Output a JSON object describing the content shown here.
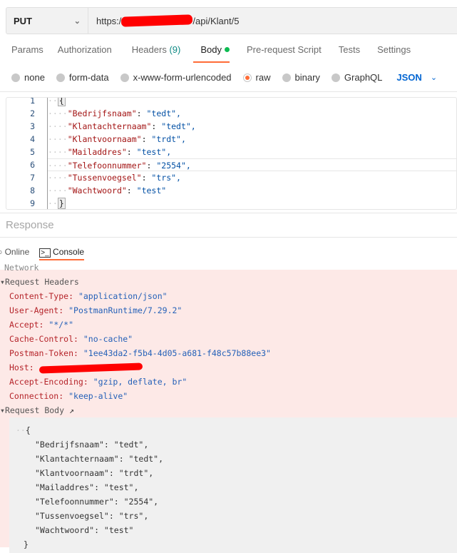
{
  "request": {
    "method": "PUT",
    "url_prefix": "https:/",
    "url_suffix": "/api/Klant/5"
  },
  "tabs": [
    {
      "label": "Params"
    },
    {
      "label": "Authorization"
    },
    {
      "label": "Headers",
      "count": "(9)"
    },
    {
      "label": "Body"
    },
    {
      "label": "Pre-request Script"
    },
    {
      "label": "Tests"
    },
    {
      "label": "Settings"
    }
  ],
  "body_types": [
    "none",
    "form-data",
    "x-www-form-urlencoded",
    "raw",
    "binary",
    "GraphQL"
  ],
  "selected_body_type": "raw",
  "format": "JSON",
  "editor": {
    "line_numbers": [
      "1",
      "2",
      "3",
      "4",
      "5",
      "6",
      "7",
      "8",
      "9"
    ],
    "open": "{",
    "close": "}",
    "fields": [
      {
        "key": "\"Bedrijfsnaam\"",
        "value": "\"tedt\","
      },
      {
        "key": "\"Klantachternaam\"",
        "value": "\"tedt\","
      },
      {
        "key": "\"Klantvoornaam\"",
        "value": "\"trdt\","
      },
      {
        "key": "\"Mailaddres\"",
        "value": "\"test\","
      },
      {
        "key": "\"Telefoonnummer\"",
        "value": "\"2554\","
      },
      {
        "key": "\"Tussenvoegsel\"",
        "value": "\"trs\","
      },
      {
        "key": "\"Wachtwoord\"",
        "value": "\"test\""
      }
    ]
  },
  "response_label": "Response",
  "bottom_tabs": {
    "online": "Online",
    "console": "Console"
  },
  "console": {
    "network": "Network",
    "request_headers": "Request Headers",
    "headers": [
      {
        "k": "Content-Type:",
        "v": "\"application/json\""
      },
      {
        "k": "User-Agent:",
        "v": "\"PostmanRuntime/7.29.2\""
      },
      {
        "k": "Accept:",
        "v": "\"*/*\""
      },
      {
        "k": "Cache-Control:",
        "v": "\"no-cache\""
      },
      {
        "k": "Postman-Token:",
        "v": "\"1ee43da2-f5b4-4d05-a681-f48c57b88ee3\""
      },
      {
        "k": "Host:",
        "v": ""
      },
      {
        "k": "Accept-Encoding:",
        "v": "\"gzip, deflate, br\""
      },
      {
        "k": "Connection:",
        "v": "\"keep-alive\""
      }
    ],
    "request_body": "Request Body",
    "body_lines": [
      "{",
      "\"Bedrijfsnaam\": \"tedt\",",
      "\"Klantachternaam\": \"tedt\",",
      "\"Klantvoornaam\": \"trdt\",",
      "\"Mailaddres\": \"test\",",
      "\"Telefoonnummer\": \"2554\",",
      "\"Tussenvoegsel\": \"trs\",",
      "\"Wachtwoord\": \"test\"",
      "}"
    ]
  },
  "colors": {
    "accent": "#ff6c37",
    "console_bg": "#fde9e7",
    "redaction": "#ff0000"
  }
}
